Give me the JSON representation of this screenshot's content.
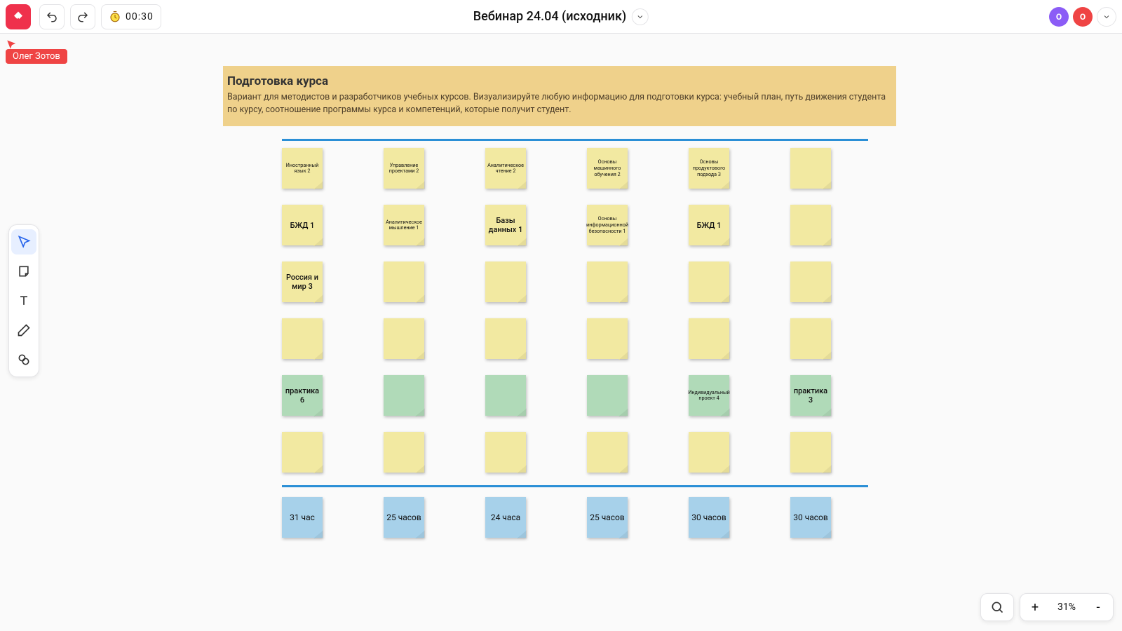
{
  "header": {
    "title": "Вебинар 24.04 (исходник)",
    "timer": "00:30",
    "avatars": [
      {
        "initial": "O",
        "color": "purple"
      },
      {
        "initial": "O",
        "color": "red"
      }
    ]
  },
  "cursor_user": "Олег Зотов",
  "banner": {
    "title": "Подготовка курса",
    "body": "Вариант для методистов и разработчиков учебных курсов. Визуализируйте любую информацию для подготовки курса: учебный план, путь движения студента по курсу, соотношение программы курса и компетенций, которые получит студент."
  },
  "rows": [
    [
      {
        "t": "Иностранный язык 2",
        "c": "yellow"
      },
      {
        "t": "Управление проектами 2",
        "c": "yellow"
      },
      {
        "t": "Аналитическое чтение 2",
        "c": "yellow"
      },
      {
        "t": "Основы машинного обучения 2",
        "c": "yellow"
      },
      {
        "t": "Основы продуктового подхода  3",
        "c": "yellow"
      },
      {
        "t": "",
        "c": "yellow"
      }
    ],
    [
      {
        "t": "БЖД 1",
        "c": "yellow",
        "big": true
      },
      {
        "t": "Аналитическое мышление 1",
        "c": "yellow"
      },
      {
        "t": "Базы данных 1",
        "c": "yellow",
        "big": true
      },
      {
        "t": "Основы информационной безопасности 1",
        "c": "yellow"
      },
      {
        "t": "БЖД 1",
        "c": "yellow",
        "big": true
      },
      {
        "t": "",
        "c": "yellow"
      }
    ],
    [
      {
        "t": "Россия и мир 3",
        "c": "yellow",
        "big": true
      },
      {
        "t": "",
        "c": "yellow"
      },
      {
        "t": "",
        "c": "yellow"
      },
      {
        "t": "",
        "c": "yellow"
      },
      {
        "t": "",
        "c": "yellow"
      },
      {
        "t": "",
        "c": "yellow"
      }
    ],
    [
      {
        "t": "",
        "c": "yellow"
      },
      {
        "t": "",
        "c": "yellow"
      },
      {
        "t": "",
        "c": "yellow"
      },
      {
        "t": "",
        "c": "yellow"
      },
      {
        "t": "",
        "c": "yellow"
      },
      {
        "t": "",
        "c": "yellow"
      }
    ],
    [
      {
        "t": "практика 6",
        "c": "green",
        "big": true
      },
      {
        "t": "",
        "c": "green"
      },
      {
        "t": "",
        "c": "green"
      },
      {
        "t": "",
        "c": "green"
      },
      {
        "t": "Индивидуальный проект 4",
        "c": "green"
      },
      {
        "t": "практика 3",
        "c": "green",
        "big": true
      }
    ],
    [
      {
        "t": "",
        "c": "yellow"
      },
      {
        "t": "",
        "c": "yellow"
      },
      {
        "t": "",
        "c": "yellow"
      },
      {
        "t": "",
        "c": "yellow"
      },
      {
        "t": "",
        "c": "yellow"
      },
      {
        "t": "",
        "c": "yellow"
      }
    ]
  ],
  "totals": [
    "31 час",
    "25 часов",
    "24 часа",
    "25 часов",
    "30 часов",
    "30 часов"
  ],
  "zoom": "31%"
}
